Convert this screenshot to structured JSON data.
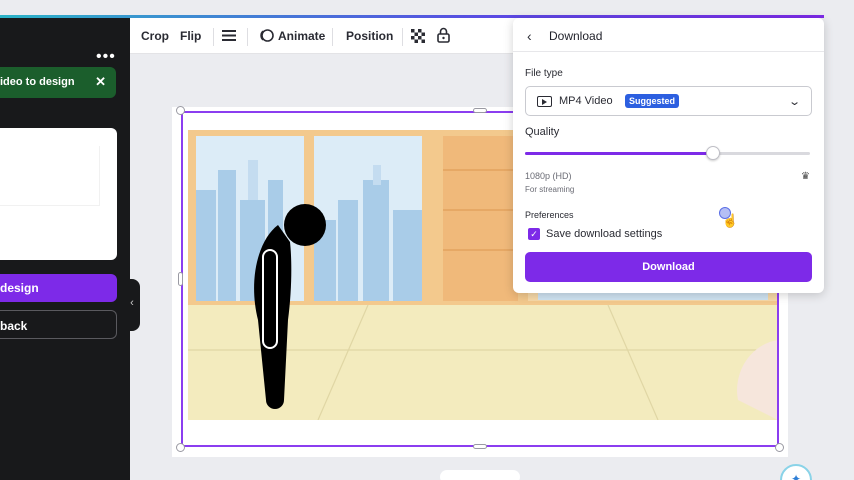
{
  "left_panel": {
    "menu_icon": "more-dots-icon",
    "toast_text": "ideo to design",
    "toast_close_icon": "close-icon",
    "primary_button_label": "design",
    "secondary_button_label": "back",
    "collapse_icon": "chevron-left-icon"
  },
  "toolbar": {
    "crop_label": "Crop",
    "flip_label": "Flip",
    "align_icon": "align-lines-icon",
    "animate_label": "Animate",
    "position_label": "Position",
    "transparency_icon": "checkerboard-icon",
    "lock_icon": "lock-icon"
  },
  "download_panel": {
    "back_icon": "chevron-left-icon",
    "title": "Download",
    "file_type_label": "File type",
    "file_type_value": "MP4 Video",
    "suggested_badge": "Suggested",
    "quality_label": "Quality",
    "quality_level_fraction": 0.66,
    "resolution": "1080p (HD)",
    "resolution_note": "For streaming",
    "premium_icon": "crown-icon",
    "preferences_label": "Preferences",
    "save_settings_label": "Save download settings",
    "save_settings_checked": true,
    "download_button_label": "Download"
  },
  "colors": {
    "accent": "#7d2ae8",
    "badge_blue": "#2c5fe0",
    "toast_green": "#1b5e2c",
    "sidebar_dark": "#18191b"
  }
}
